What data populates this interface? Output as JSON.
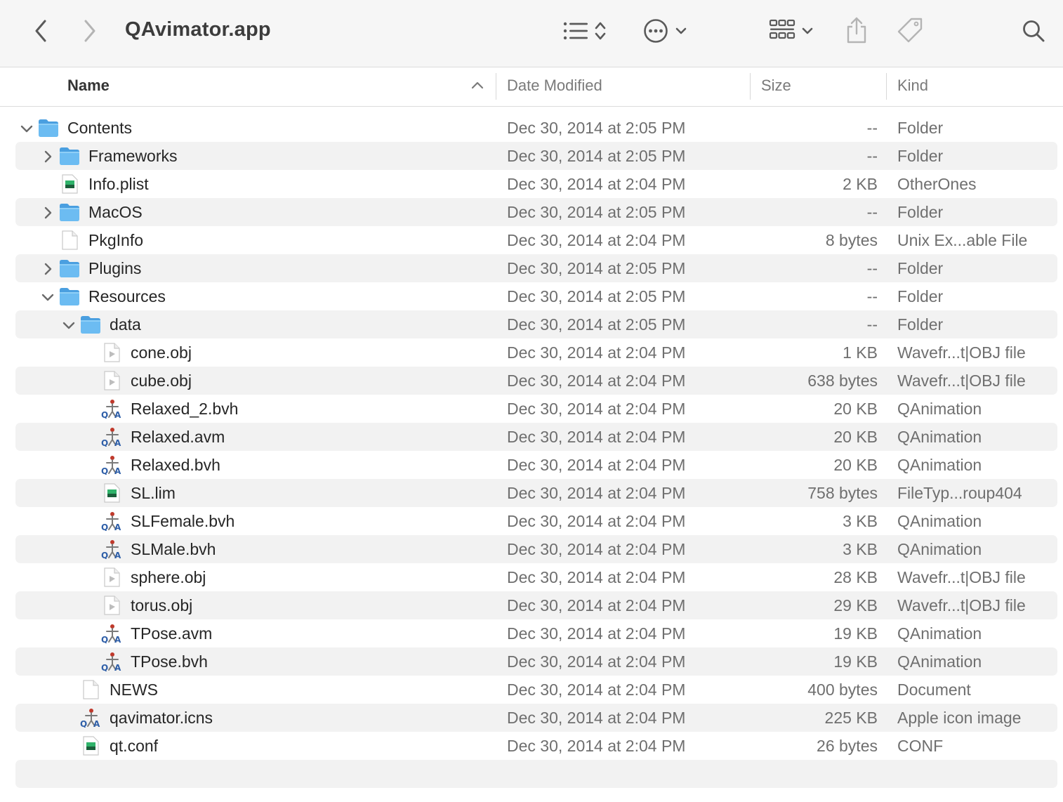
{
  "window": {
    "title": "QAvimator.app"
  },
  "toolbar": {
    "back_icon": "chevron-left-icon",
    "forward_icon": "chevron-right-icon",
    "view_options_icon": "list-view-icon",
    "action_icon": "ellipsis-circle-icon",
    "group_icon": "grid-group-icon",
    "share_icon": "share-icon",
    "tag_icon": "tag-icon",
    "search_icon": "search-icon"
  },
  "columns": {
    "name": "Name",
    "date_modified": "Date Modified",
    "size": "Size",
    "kind": "Kind",
    "sort_column": "name",
    "sort_direction": "ascending"
  },
  "colors": {
    "folder_blue": "#5aaee8",
    "stripe_gray": "#f2f2f2",
    "qa_blue": "#2f5fa8",
    "plist_green": "#1f9d55"
  },
  "files": [
    {
      "name": "Contents",
      "date": "Dec 30, 2014 at 2:05 PM",
      "size": "--",
      "kind": "Folder",
      "icon": "folder-icon",
      "level": 0,
      "disclosure": "expanded"
    },
    {
      "name": "Frameworks",
      "date": "Dec 30, 2014 at 2:05 PM",
      "size": "--",
      "kind": "Folder",
      "icon": "folder-icon",
      "level": 1,
      "disclosure": "collapsed"
    },
    {
      "name": "Info.plist",
      "date": "Dec 30, 2014 at 2:04 PM",
      "size": "2 KB",
      "kind": "OtherOnes",
      "icon": "plist-file-icon",
      "level": 1,
      "disclosure": "none"
    },
    {
      "name": "MacOS",
      "date": "Dec 30, 2014 at 2:05 PM",
      "size": "--",
      "kind": "Folder",
      "icon": "folder-icon",
      "level": 1,
      "disclosure": "collapsed"
    },
    {
      "name": "PkgInfo",
      "date": "Dec 30, 2014 at 2:04 PM",
      "size": "8 bytes",
      "kind": "Unix Ex...able File",
      "icon": "blank-document-icon",
      "level": 1,
      "disclosure": "none"
    },
    {
      "name": "Plugins",
      "date": "Dec 30, 2014 at 2:05 PM",
      "size": "--",
      "kind": "Folder",
      "icon": "folder-icon",
      "level": 1,
      "disclosure": "collapsed"
    },
    {
      "name": "Resources",
      "date": "Dec 30, 2014 at 2:05 PM",
      "size": "--",
      "kind": "Folder",
      "icon": "folder-icon",
      "level": 1,
      "disclosure": "expanded"
    },
    {
      "name": "data",
      "date": "Dec 30, 2014 at 2:05 PM",
      "size": "--",
      "kind": "Folder",
      "icon": "folder-icon",
      "level": 2,
      "disclosure": "expanded"
    },
    {
      "name": "cone.obj",
      "date": "Dec 30, 2014 at 2:04 PM",
      "size": "1 KB",
      "kind": "Wavefr...t|OBJ file",
      "icon": "obj-file-icon",
      "level": 3,
      "disclosure": "none"
    },
    {
      "name": "cube.obj",
      "date": "Dec 30, 2014 at 2:04 PM",
      "size": "638 bytes",
      "kind": "Wavefr...t|OBJ file",
      "icon": "obj-file-icon",
      "level": 3,
      "disclosure": "none"
    },
    {
      "name": "Relaxed_2.bvh",
      "date": "Dec 30, 2014 at 2:04 PM",
      "size": "20 KB",
      "kind": "QAnimation",
      "icon": "qavimator-file-icon",
      "level": 3,
      "disclosure": "none"
    },
    {
      "name": "Relaxed.avm",
      "date": "Dec 30, 2014 at 2:04 PM",
      "size": "20 KB",
      "kind": "QAnimation",
      "icon": "qavimator-file-icon",
      "level": 3,
      "disclosure": "none"
    },
    {
      "name": "Relaxed.bvh",
      "date": "Dec 30, 2014 at 2:04 PM",
      "size": "20 KB",
      "kind": "QAnimation",
      "icon": "qavimator-file-icon",
      "level": 3,
      "disclosure": "none"
    },
    {
      "name": "SL.lim",
      "date": "Dec 30, 2014 at 2:04 PM",
      "size": "758 bytes",
      "kind": "FileTyp...roup404",
      "icon": "plist-file-icon",
      "level": 3,
      "disclosure": "none"
    },
    {
      "name": "SLFemale.bvh",
      "date": "Dec 30, 2014 at 2:04 PM",
      "size": "3 KB",
      "kind": "QAnimation",
      "icon": "qavimator-file-icon",
      "level": 3,
      "disclosure": "none"
    },
    {
      "name": "SLMale.bvh",
      "date": "Dec 30, 2014 at 2:04 PM",
      "size": "3 KB",
      "kind": "QAnimation",
      "icon": "qavimator-file-icon",
      "level": 3,
      "disclosure": "none"
    },
    {
      "name": "sphere.obj",
      "date": "Dec 30, 2014 at 2:04 PM",
      "size": "28 KB",
      "kind": "Wavefr...t|OBJ file",
      "icon": "obj-file-icon",
      "level": 3,
      "disclosure": "none"
    },
    {
      "name": "torus.obj",
      "date": "Dec 30, 2014 at 2:04 PM",
      "size": "29 KB",
      "kind": "Wavefr...t|OBJ file",
      "icon": "obj-file-icon",
      "level": 3,
      "disclosure": "none"
    },
    {
      "name": "TPose.avm",
      "date": "Dec 30, 2014 at 2:04 PM",
      "size": "19 KB",
      "kind": "QAnimation",
      "icon": "qavimator-file-icon",
      "level": 3,
      "disclosure": "none"
    },
    {
      "name": "TPose.bvh",
      "date": "Dec 30, 2014 at 2:04 PM",
      "size": "19 KB",
      "kind": "QAnimation",
      "icon": "qavimator-file-icon",
      "level": 3,
      "disclosure": "none"
    },
    {
      "name": "NEWS",
      "date": "Dec 30, 2014 at 2:04 PM",
      "size": "400 bytes",
      "kind": "Document",
      "icon": "blank-document-icon",
      "level": 2,
      "disclosure": "none"
    },
    {
      "name": "qavimator.icns",
      "date": "Dec 30, 2014 at 2:04 PM",
      "size": "225 KB",
      "kind": "Apple icon image",
      "icon": "qavimator-file-icon",
      "level": 2,
      "disclosure": "none"
    },
    {
      "name": "qt.conf",
      "date": "Dec 30, 2014 at 2:04 PM",
      "size": "26 bytes",
      "kind": "CONF",
      "icon": "plist-file-icon",
      "level": 2,
      "disclosure": "none"
    }
  ]
}
